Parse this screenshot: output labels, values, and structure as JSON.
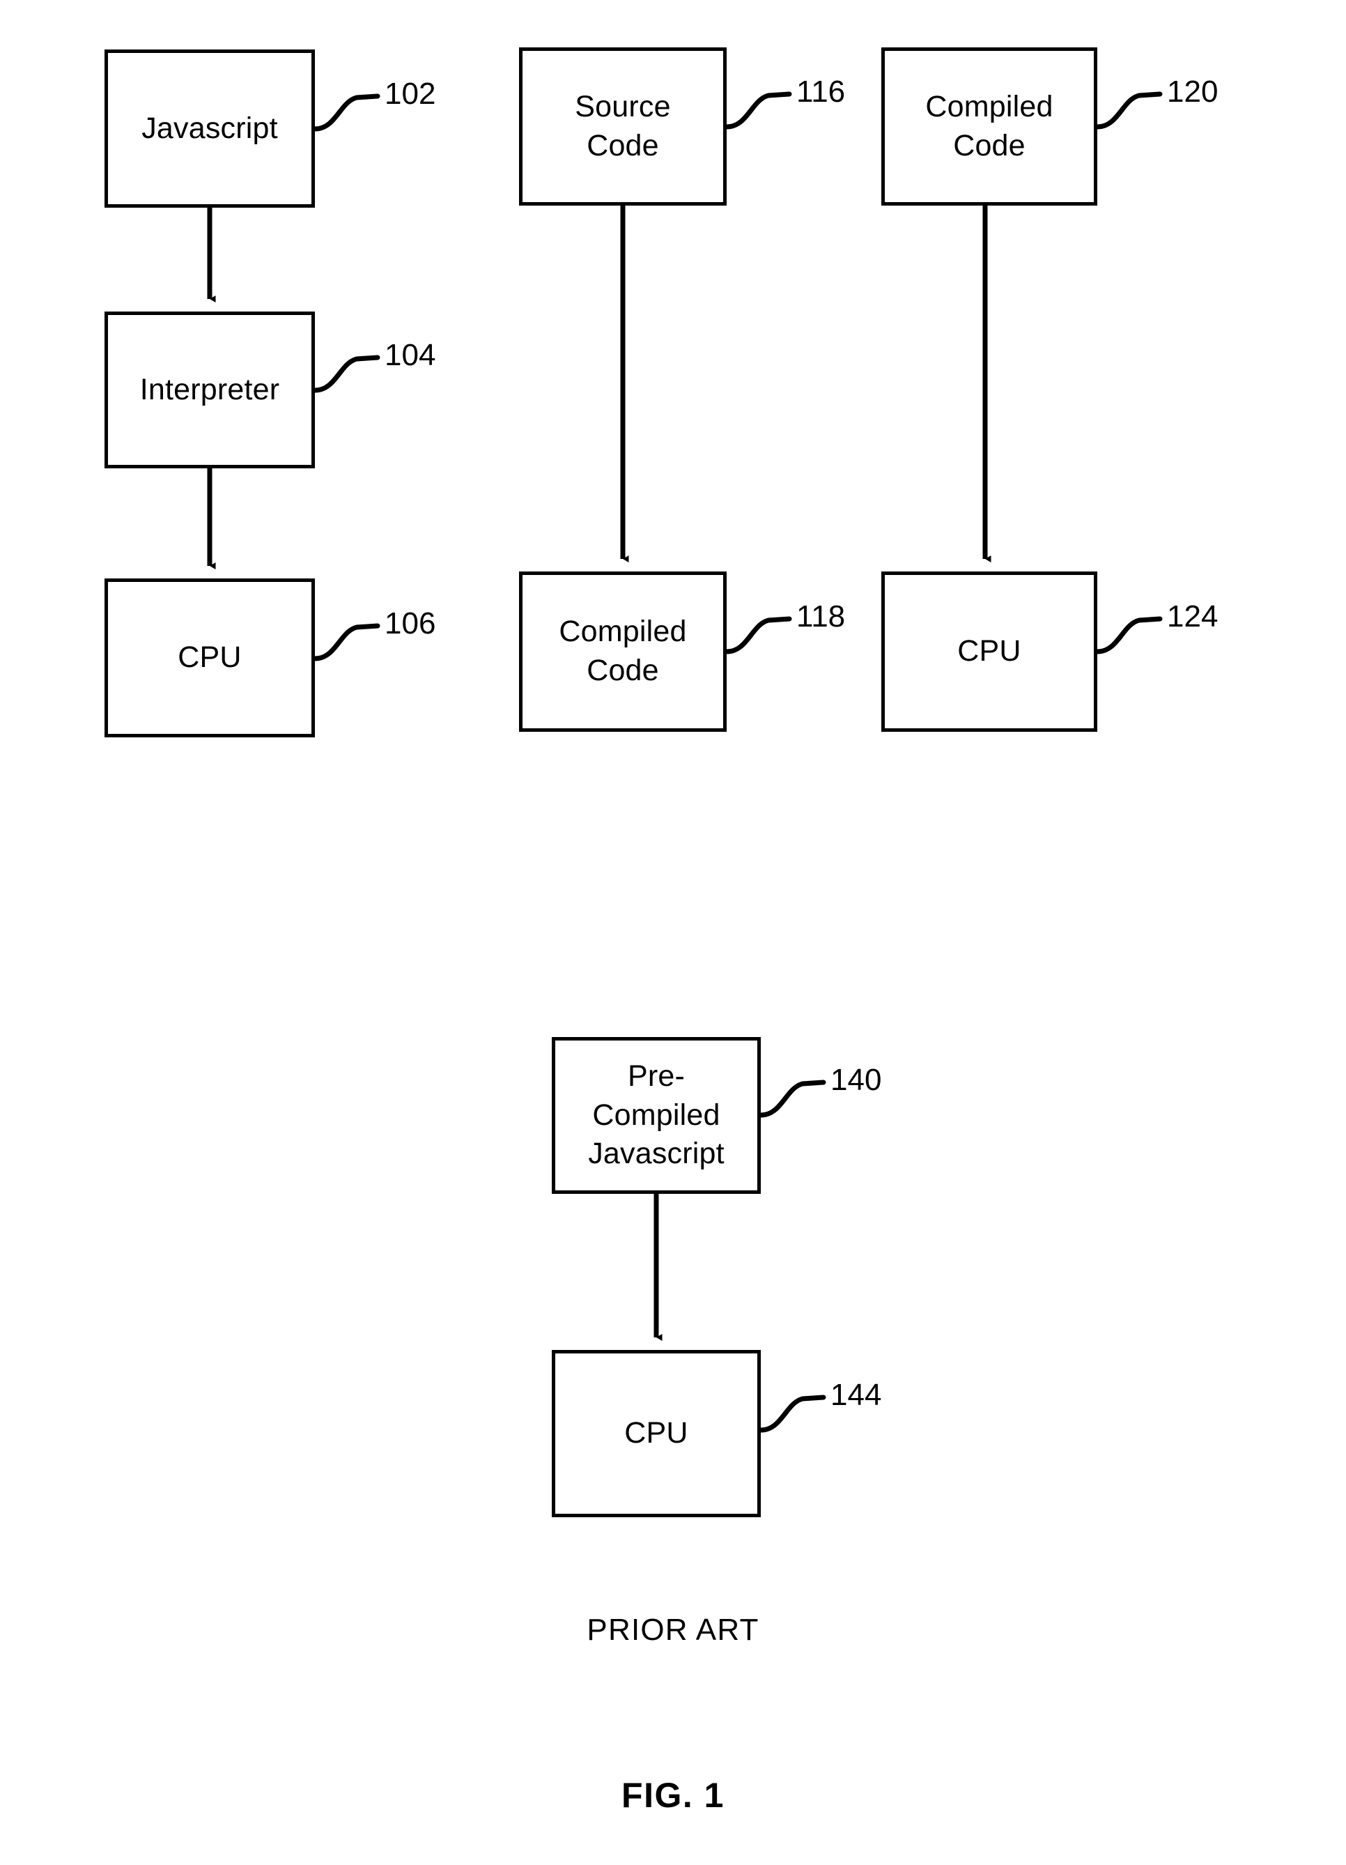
{
  "figure": {
    "title": "FIG. 1",
    "prior_art_note": "PRIOR ART"
  },
  "flows": [
    {
      "id": "interpreted-javascript-flow",
      "nodes": [
        {
          "id": "javascript",
          "lines": [
            "Javascript"
          ],
          "ref": "102"
        },
        {
          "id": "interpreter",
          "lines": [
            "Interpreter"
          ],
          "ref": "104"
        },
        {
          "id": "cpu-interpreted",
          "lines": [
            "CPU"
          ],
          "ref": "106"
        }
      ]
    },
    {
      "id": "compilation-flow",
      "nodes": [
        {
          "id": "source-code",
          "lines": [
            "Source",
            "Code"
          ],
          "ref": "116"
        },
        {
          "id": "compiled-code-output",
          "lines": [
            "Compiled",
            "Code"
          ],
          "ref": "118"
        }
      ]
    },
    {
      "id": "compiled-execution-flow",
      "nodes": [
        {
          "id": "compiled-code-input",
          "lines": [
            "Compiled",
            "Code"
          ],
          "ref": "120"
        },
        {
          "id": "cpu-compiled",
          "lines": [
            "CPU"
          ],
          "ref": "124"
        }
      ]
    },
    {
      "id": "precompiled-javascript-flow",
      "nodes": [
        {
          "id": "pre-compiled-javascript",
          "lines": [
            "Pre-",
            "Compiled",
            "Javascript"
          ],
          "ref": "140"
        },
        {
          "id": "cpu-precompiled",
          "lines": [
            "CPU"
          ],
          "ref": "144"
        }
      ]
    }
  ],
  "nodes": {
    "javascript": {
      "line0": "Javascript",
      "ref": "102"
    },
    "interpreter": {
      "line0": "Interpreter",
      "ref": "104"
    },
    "cpu_interpreted": {
      "line0": "CPU",
      "ref": "106"
    },
    "source_code": {
      "line0": "Source",
      "line1": "Code",
      "ref": "116"
    },
    "compiled_code_output": {
      "line0": "Compiled",
      "line1": "Code",
      "ref": "118"
    },
    "compiled_code_input": {
      "line0": "Compiled",
      "line1": "Code",
      "ref": "120"
    },
    "cpu_compiled": {
      "line0": "CPU",
      "ref": "124"
    },
    "pre_compiled_javascript": {
      "line0": "Pre-",
      "line1": "Compiled",
      "line2": "Javascript",
      "ref": "140"
    },
    "cpu_precompiled": {
      "line0": "CPU",
      "ref": "144"
    }
  },
  "colors": {
    "stroke": "#000000",
    "background": "#ffffff",
    "text": "#000000"
  }
}
